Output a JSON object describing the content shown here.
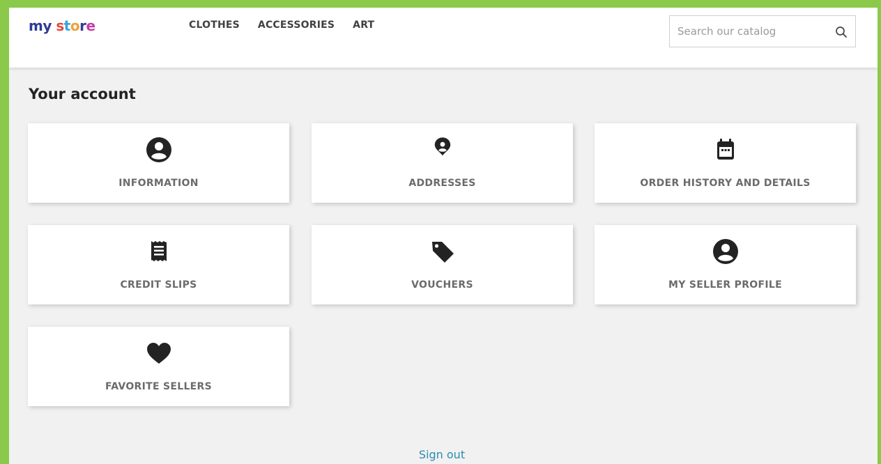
{
  "colors": {
    "accent": "#2a8db0",
    "icon": "#232323",
    "label": "#6b6b6b",
    "frame": "#8bc94a"
  },
  "header": {
    "logo": {
      "text": "my store",
      "letters": [
        {
          "char": "m",
          "color": "#2f3b96"
        },
        {
          "char": "y",
          "color": "#2f3b96"
        },
        {
          "char": " ",
          "color": "#2f3b96"
        },
        {
          "char": "s",
          "color": "#e5473a"
        },
        {
          "char": "t",
          "color": "#37a4d8"
        },
        {
          "char": "o",
          "color": "#f2a03a"
        },
        {
          "char": "r",
          "color": "#2f3b96"
        },
        {
          "char": "e",
          "color": "#c73aa8"
        }
      ]
    },
    "nav": [
      "CLOTHES",
      "ACCESSORIES",
      "ART"
    ],
    "search": {
      "placeholder": "Search our catalog",
      "value": "",
      "icon": "search-icon"
    }
  },
  "page": {
    "title": "Your account",
    "cards": [
      {
        "label": "INFORMATION",
        "icon": "account-circle-icon"
      },
      {
        "label": "ADDRESSES",
        "icon": "location-pin-icon"
      },
      {
        "label": "ORDER HISTORY AND DETAILS",
        "icon": "calendar-icon"
      },
      {
        "label": "CREDIT SLIPS",
        "icon": "receipt-icon"
      },
      {
        "label": "VOUCHERS",
        "icon": "tag-icon"
      },
      {
        "label": "MY SELLER PROFILE",
        "icon": "account-circle-icon"
      },
      {
        "label": "FAVORITE SELLERS",
        "icon": "heart-icon"
      }
    ],
    "signout": "Sign out"
  }
}
